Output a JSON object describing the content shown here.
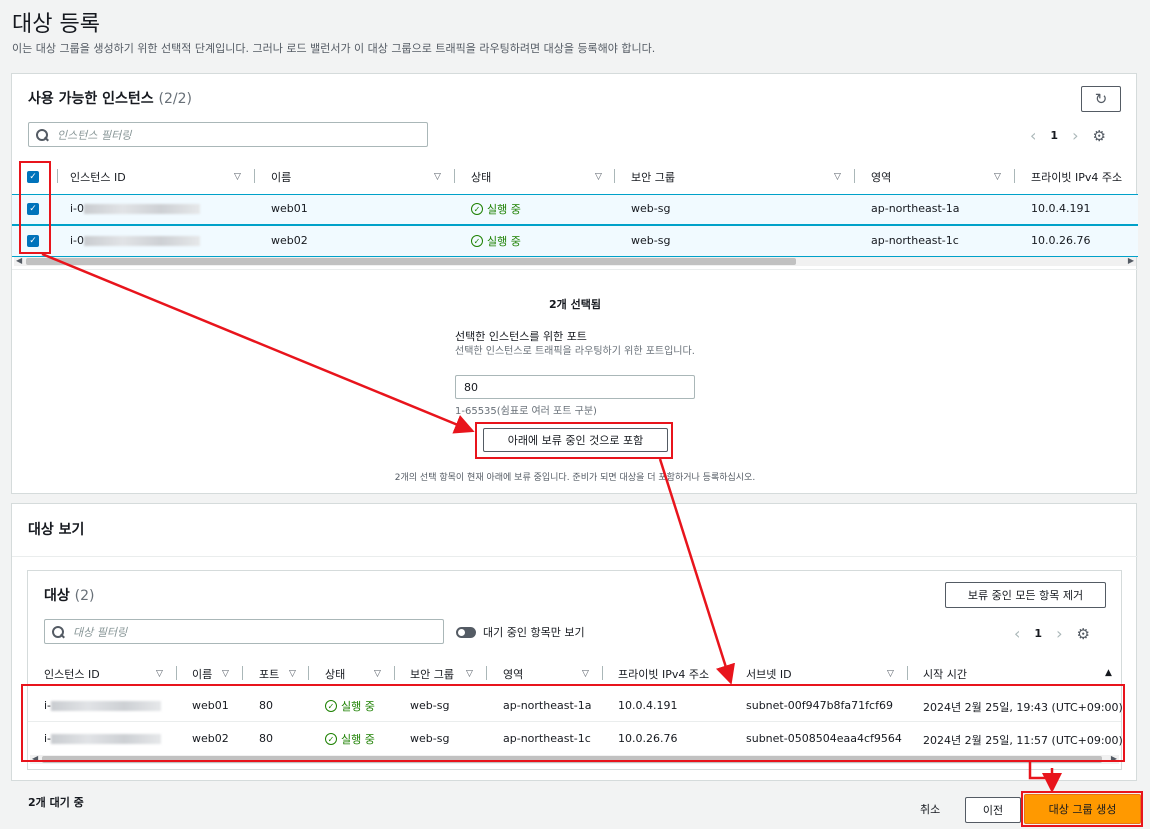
{
  "page": {
    "title": "대상 등록",
    "description": "이는 대상 그룹을 생성하기 위한 선택적 단계입니다. 그러나 로드 밸런서가 이 대상 그룹으로 트래픽을 라우팅하려면 대상을 등록해야 합니다."
  },
  "available": {
    "title": "사용 가능한 인스턴스",
    "count": "(2/2)",
    "refresh_icon": "refresh-icon",
    "search_placeholder": "인스턴스 필터링",
    "page": "1",
    "columns": [
      "인스턴스 ID",
      "이름",
      "상태",
      "보안 그룹",
      "영역",
      "프라이빗 IPv4 주소"
    ],
    "rows": [
      {
        "id": "i-0",
        "name": "web01",
        "state": "실행 중",
        "sg": "web-sg",
        "zone": "ap-northeast-1a",
        "ip": "10.0.4.191"
      },
      {
        "id": "i-0",
        "name": "web02",
        "state": "실행 중",
        "sg": "web-sg",
        "zone": "ap-northeast-1c",
        "ip": "10.0.26.76"
      }
    ],
    "selected_count": "2개 선택됨",
    "port_label": "선택한 인스턴스를 위한 포트",
    "port_desc": "선택한 인스턴스로 트래픽을 라우팅하기 위한 포트입니다.",
    "port_value": "80",
    "port_hint": "1-65535(쉼표로 여러 포트 구분)",
    "include_button": "아래에 보류 중인 것으로 포함",
    "footnote": "2개의 선택 항목이 현재 아래에 보류 중입니다. 준비가 되면 대상을 더 포함하거나 등록하십시오."
  },
  "review": {
    "title": "대상 보기",
    "targets_title": "대상",
    "targets_count": "(2)",
    "remove_all_button": "보류 중인 모든 항목 제거",
    "search_placeholder": "대상 필터링",
    "toggle_label": "대기 중인 항목만 보기",
    "page": "1",
    "columns": [
      "인스턴스 ID",
      "이름",
      "포트",
      "상태",
      "보안 그룹",
      "영역",
      "프라이빗 IPv4 주소",
      "서브넷 ID",
      "시작 시간"
    ],
    "rows": [
      {
        "id": "i-",
        "name": "web01",
        "port": "80",
        "state": "실행 중",
        "sg": "web-sg",
        "zone": "ap-northeast-1a",
        "ip": "10.0.4.191",
        "subnet": "subnet-00f947b8fa71fcf69",
        "start": "2024년 2월 25일, 19:43 (UTC+09:00)"
      },
      {
        "id": "i-",
        "name": "web02",
        "port": "80",
        "state": "실행 중",
        "sg": "web-sg",
        "zone": "ap-northeast-1c",
        "ip": "10.0.26.76",
        "subnet": "subnet-0508504eaa4cf9564",
        "start": "2024년 2월 25일, 11:57 (UTC+09:00)"
      }
    ]
  },
  "footer": {
    "pending_count": "2개 대기 중",
    "cancel": "취소",
    "previous": "이전",
    "create": "대상 그룹 생성"
  },
  "colors": {
    "accent": "#0073bb",
    "primary_button": "#ff9900",
    "annotation": "#e8141c",
    "success": "#1d8102"
  }
}
